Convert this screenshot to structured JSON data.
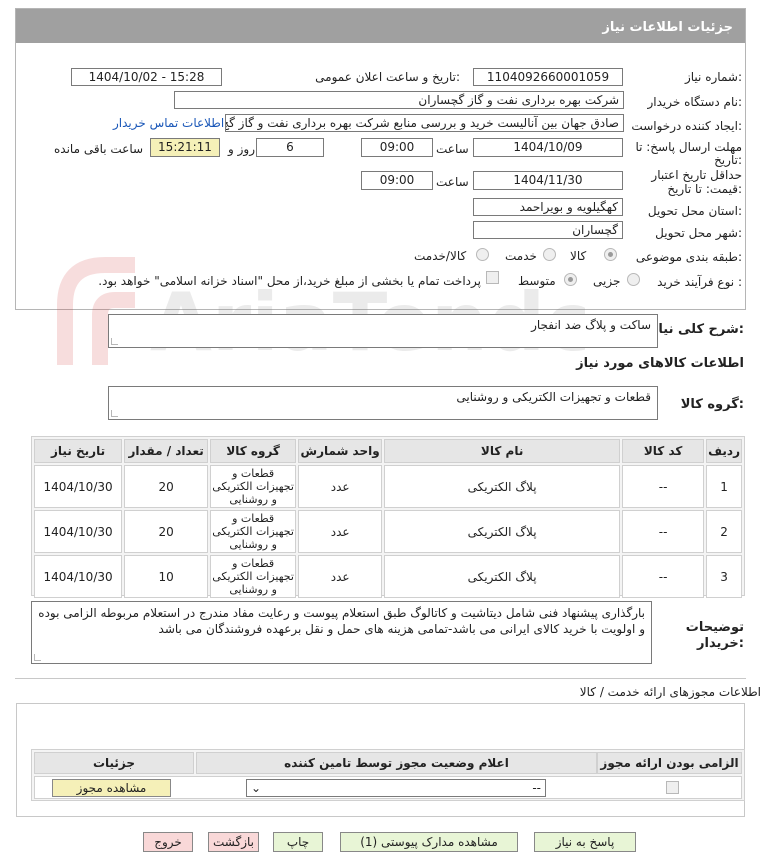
{
  "header": {
    "title": "جزئیات اطلاعات نیاز"
  },
  "fields": {
    "need_number_label": "شماره نیاز:",
    "need_number": "1104092660001059",
    "announce_label": "تاریخ و ساعت اعلان عمومی:",
    "announce_value": "1404/10/02 - 15:28",
    "buyer_org_label": "نام دستگاه خریدار:",
    "buyer_org": "شرکت بهره برداری نفت و گاز گچساران",
    "requester_label": "ایجاد کننده درخواست:",
    "requester": "صادق جهان بین آنالیست خرید و بررسی منابع شرکت بهره برداری نفت و گاز گچ",
    "contact_link": "اطلاعات تماس خریدار",
    "deadline_label_1": "مهلت ارسال پاسخ: تا",
    "deadline_label_2": "تاریخ:",
    "deadline_date": "1404/10/09",
    "time_label": "ساعت",
    "deadline_time": "09:00",
    "days_value": "6",
    "days_label": "روز و",
    "remaining_time": "15:21:11",
    "remaining_label": "ساعت باقی مانده",
    "validity_label_1": "حداقل تاریخ اعتبار",
    "validity_label_2": "قیمت: تا تاریخ:",
    "validity_date": "1404/11/30",
    "validity_time_label": "ساعت",
    "validity_time": "09:00",
    "province_label": "استان محل تحویل:",
    "province": "کهگیلویه و بویراحمد",
    "city_label": "شهر محل تحویل:",
    "city": "گچساران",
    "category_label": "طبقه بندی موضوعی:",
    "category_options": [
      "کالا",
      "خدمت",
      "کالا/خدمت"
    ],
    "purchase_type_label": "نوع فرآیند خرید :",
    "purchase_options": [
      "جزیی",
      "متوسط"
    ],
    "payment_note": "پرداخت تمام یا بخشی از مبلغ خرید،از محل \"اسناد خزانه اسلامی\" خواهد بود."
  },
  "summary": {
    "label": "شرح کلی نیاز:",
    "value": "ساکت و پلاگ ضد انفجار"
  },
  "goods_section": {
    "title": "اطلاعات کالاهای مورد نیاز",
    "group_label": "گروه کالا:",
    "group_value": "قطعات و تجهیزات الکتریکی و روشنایی"
  },
  "table": {
    "headers": [
      "ردیف",
      "کد کالا",
      "نام کالا",
      "واحد شمارش",
      "گروه کالا",
      "تعداد / مقدار",
      "تاریخ نیاز"
    ],
    "rows": [
      {
        "row": "1",
        "code": "--",
        "name": "پلاگ الکتریکی",
        "unit": "عدد",
        "group": "قطعات و تجهیزات الکتریکی و روشنایی",
        "qty": "20",
        "date": "1404/10/30"
      },
      {
        "row": "2",
        "code": "--",
        "name": "پلاگ الکتریکی",
        "unit": "عدد",
        "group": "قطعات و تجهیزات الکتریکی و روشنایی",
        "qty": "20",
        "date": "1404/10/30"
      },
      {
        "row": "3",
        "code": "--",
        "name": "پلاگ الکتریکی",
        "unit": "عدد",
        "group": "قطعات و تجهیزات الکتریکی و روشنایی",
        "qty": "10",
        "date": "1404/10/30"
      }
    ]
  },
  "buyer_notes": {
    "label_1": "توضیحات",
    "label_2": "خریدار:",
    "text": "بارگذاری پیشنهاد فنی شامل دیتاشیت و کاتالوگ طبق استعلام پیوست و رعایت مفاد مندرج در استعلام مربوطه الزامی بوده و اولویت با خرید کالای ایرانی می باشد-تمامی هزینه های حمل و نقل برعهده فروشندگان می باشد"
  },
  "permits": {
    "title": "اطلاعات مجوزهای ارائه خدمت / کالا",
    "headers": [
      "الزامی بودن ارائه مجوز",
      "اعلام وضعیت مجوز توسط تامین کننده",
      "جزئیات"
    ],
    "select_value": "--",
    "view_button": "مشاهده مجوز"
  },
  "buttons": {
    "reply": "پاسخ به نیاز",
    "attachments": "مشاهده مدارک پیوستی (1)",
    "print": "چاپ",
    "back": "بازگشت",
    "exit": "خروج"
  },
  "colors": {
    "header": "#a0a0a0",
    "accent_link": "#1a57b8",
    "yellow": "#f5f0b8"
  },
  "watermark_text": "AriaTender.neT"
}
